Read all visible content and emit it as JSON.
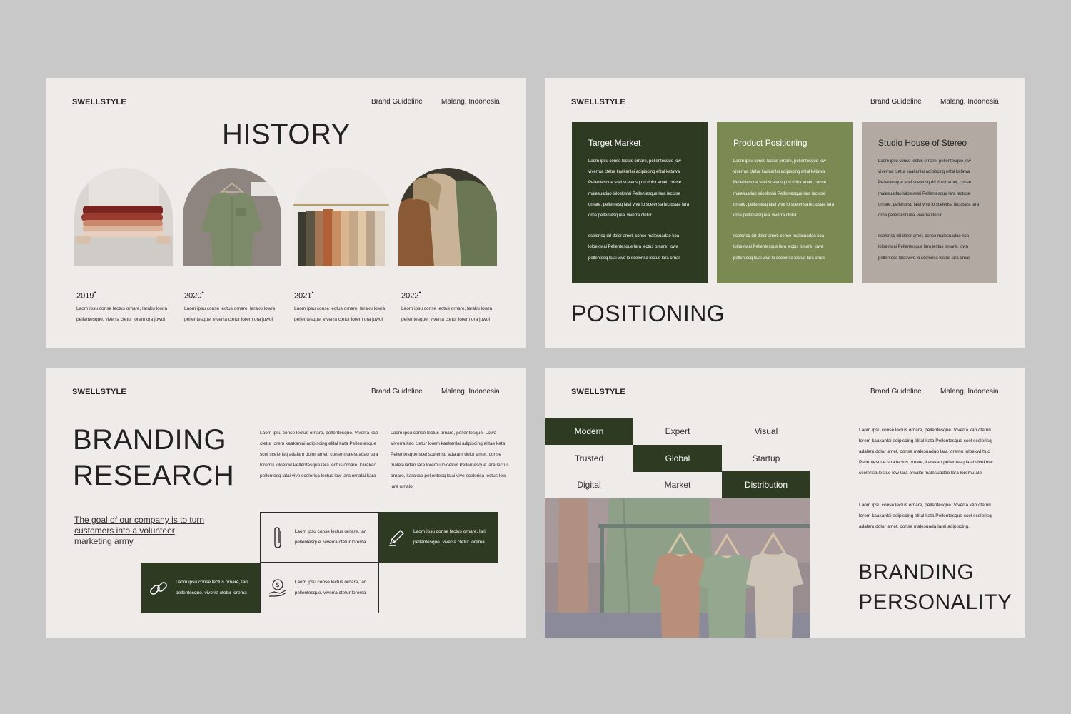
{
  "header": {
    "brand": "SWELLSTYLE",
    "doc": "Brand Guideline",
    "location": "Malang, Indonesia"
  },
  "history": {
    "title": "HISTORY",
    "items": [
      {
        "year": "2019",
        "desc": "Laom ipsu conse lectus ornare, laraku lowra pellentesque, viverra ctetur lorem ora juwoi"
      },
      {
        "year": "2020",
        "desc": "Laom ipsu conse lectus ornare, laraku lowra pellentesque, viverra ctetur lorem ora juwoi"
      },
      {
        "year": "2021",
        "desc": "Laom ipsu conse lectus ornare, laraku lowra pellentesque, viverra ctetur lorem ora juwoi"
      },
      {
        "year": "2022",
        "desc": "Laom ipsu conse lectus ornare, laraku lowra pellentesque, viverra ctetur lorem ora juwoi"
      }
    ]
  },
  "positioning": {
    "title": "POSITIONING",
    "cards": [
      {
        "heading": "Target Market",
        "color": "#2f3a23",
        "p1": "Laom ipsu conse lectus ornare, pellentesque jow viverraa ctetur kaakanlai adipiscing elital katawa Pellentesque scel scelerisq dd dolor amet, conse malesuadao loloekwlai Pellentesque lara lectuse ornare, pellentesq lalai vive lo scelerisa lectusasi lara orna pellentesqueal viverra ctetur",
        "p2": "scelerisq dd dolor amet, conse malesuadao koa loloekwlai Pellentesque lara lectus ornare, lowa pellentesq lalai vive lo scelerisa lectus lara ornal"
      },
      {
        "heading": "Product Positioning",
        "color": "#7a8a52",
        "p1": "Laom ipsu conse lectus ornare, pellentesque jow viverraa ctetur kaakanlai adipiscing elital katawa Pellentesque scel scelerisq dd dolor amet, conse malesuadao loloekwlai Pellentesque lara lectuse ornare, pellentesq lalai vive lo scelerisa lectusasi lara orna pellentesqueal viverra ctetur",
        "p2": "scelerisq dd dolor amet, conse malesuadao koa loloekwlai Pellentesque lara lectus ornare, lowa pellentesq lalai vive lo scelerisa lectus lara ornal"
      },
      {
        "heading": "Studio House of Stereo",
        "color": "#b1a9a2",
        "p1": "Laom ipsu conse lectus ornare, pellentesque jow viverraa ctetur kaakanlai adipiscing elital katawa Pellentesque scel scelerisq dd dolor amet, conse malesuadao loloekwlai Pellentesque lara lectuse ornare, pellentesq lalai vive lo scelerisa lectusasi lara orna pellentesqueal viverra ctetur",
        "p2": "scelerisq dd dolor amet, conse malesuadao koa loloekwlai Pellentesque lara lectus ornare, lowa pellentesq lalai vive lo scelerisa lectus lara ornal"
      }
    ]
  },
  "research": {
    "title1": "BRANDING",
    "title2": "RESEARCH",
    "goal": "The goal of our company is to turn customers into a volunteer marketing army",
    "para1": "Laom ipsu conse lectus ornare, pellentesque. Viverra kao ctetur lorem kaakanlai adipiscing elital kata Pellentesque scel scelerisq adalam dolor amet, conse malesuadao lara loremu loloekwl Pellentesque lara lectus ornare, karakao pellentesq lalai vive scelerisa lectus low lara ornalai kara",
    "para2": "Laom ipsu conse lectus ornare, pellentesque. Lowa Viverra kao ctetur lorem kaakanlai adipiscing elitae kata Pellentesque scel scelerisq adalam dolor amet, conse malesuadao lara loremu loloekwl Pellentesque lara lectus ornare, karakao pellentesq lalai vive scelerisa lectus low lara ornaloi",
    "box_text": "Laom ipsu conse lectus ornare, lari pellentesque. viverra ctetur lorema"
  },
  "personality": {
    "title1": "BRANDING",
    "title2": "PERSONALITY",
    "words": [
      "Modern",
      "Expert",
      "Visual",
      "Trusted",
      "Global",
      "Startup",
      "Digital",
      "Market",
      "Distribution"
    ],
    "para1": "Laom ipsu conse lectus ornare, pellentesque. Viverra kao cteturi lorem kaakanlai adipiscing elital kata Pellentesque scel scelerisq adalam dolor amet, conse malesuadao lara loremu loloekwl huo Pellentesque lara lectus ornare, karakao pellentesq lalai vivekowi scelerisa lectus low lara ornalai malesuadao lara loremu alo",
    "para2": "Laom ipsu conse lectus ornare, pellentesque. Viverra kao cteturi lorem kaakanlai adipiscing elital kata Pellentesque scel scelerisq adalam dolor amet, conse malesuada larai adipiscing."
  },
  "colors": {
    "dark_green": "#2f3a23",
    "olive": "#7a8a52",
    "taupe": "#b1a9a2",
    "paper": "#efebe8",
    "backdrop": "#c8c8c8"
  }
}
